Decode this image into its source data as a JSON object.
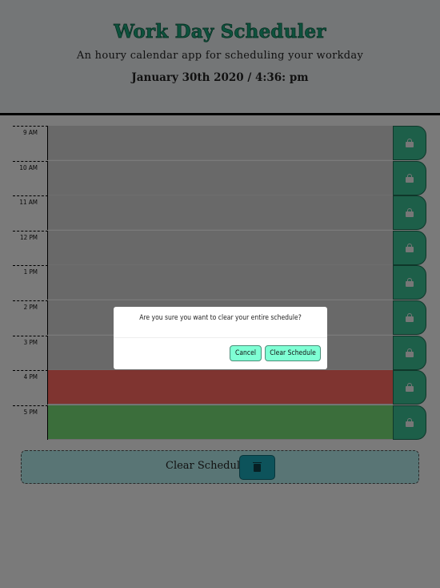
{
  "header": {
    "title": "Work Day Scheduler",
    "lead": "An houry calendar app for scheduling your workday",
    "datetime": "January 30th 2020 / 4:36: pm"
  },
  "schedule": {
    "rows": [
      {
        "hour": "9 AM",
        "state": "past",
        "text": ""
      },
      {
        "hour": "10 AM",
        "state": "past",
        "text": ""
      },
      {
        "hour": "11 AM",
        "state": "past",
        "text": ""
      },
      {
        "hour": "12 PM",
        "state": "past",
        "text": ""
      },
      {
        "hour": "1 PM",
        "state": "past",
        "text": ""
      },
      {
        "hour": "2 PM",
        "state": "past",
        "text": ""
      },
      {
        "hour": "3 PM",
        "state": "past",
        "text": ""
      },
      {
        "hour": "4 PM",
        "state": "present",
        "text": ""
      },
      {
        "hour": "5 PM",
        "state": "future",
        "text": ""
      }
    ],
    "save_icon": "lock-icon"
  },
  "clear": {
    "label": "Clear Schedule",
    "icon": "trash-icon"
  },
  "modal": {
    "message": "Are you sure you want to clear your entire schedule?",
    "cancel_label": "Cancel",
    "confirm_label": "Clear Schedule"
  },
  "colors": {
    "title": "#1aa47a",
    "past": "#d3d3d3",
    "present": "#ff6961",
    "future": "#77dd77",
    "save": "#3bbf93",
    "modal_button": "#7fffd4"
  }
}
